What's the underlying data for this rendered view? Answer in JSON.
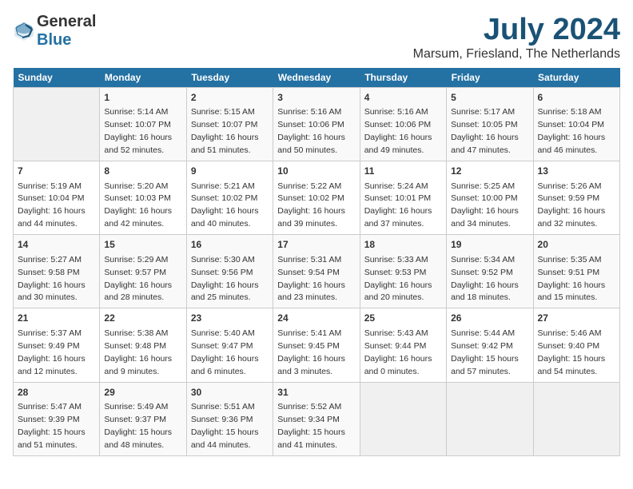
{
  "header": {
    "logo_general": "General",
    "logo_blue": "Blue",
    "month_title": "July 2024",
    "location": "Marsum, Friesland, The Netherlands"
  },
  "days_of_week": [
    "Sunday",
    "Monday",
    "Tuesday",
    "Wednesday",
    "Thursday",
    "Friday",
    "Saturday"
  ],
  "weeks": [
    [
      {
        "day": "",
        "sunrise": "",
        "sunset": "",
        "daylight": ""
      },
      {
        "day": "1",
        "sunrise": "Sunrise: 5:14 AM",
        "sunset": "Sunset: 10:07 PM",
        "daylight": "Daylight: 16 hours and 52 minutes."
      },
      {
        "day": "2",
        "sunrise": "Sunrise: 5:15 AM",
        "sunset": "Sunset: 10:07 PM",
        "daylight": "Daylight: 16 hours and 51 minutes."
      },
      {
        "day": "3",
        "sunrise": "Sunrise: 5:16 AM",
        "sunset": "Sunset: 10:06 PM",
        "daylight": "Daylight: 16 hours and 50 minutes."
      },
      {
        "day": "4",
        "sunrise": "Sunrise: 5:16 AM",
        "sunset": "Sunset: 10:06 PM",
        "daylight": "Daylight: 16 hours and 49 minutes."
      },
      {
        "day": "5",
        "sunrise": "Sunrise: 5:17 AM",
        "sunset": "Sunset: 10:05 PM",
        "daylight": "Daylight: 16 hours and 47 minutes."
      },
      {
        "day": "6",
        "sunrise": "Sunrise: 5:18 AM",
        "sunset": "Sunset: 10:04 PM",
        "daylight": "Daylight: 16 hours and 46 minutes."
      }
    ],
    [
      {
        "day": "7",
        "sunrise": "Sunrise: 5:19 AM",
        "sunset": "Sunset: 10:04 PM",
        "daylight": "Daylight: 16 hours and 44 minutes."
      },
      {
        "day": "8",
        "sunrise": "Sunrise: 5:20 AM",
        "sunset": "Sunset: 10:03 PM",
        "daylight": "Daylight: 16 hours and 42 minutes."
      },
      {
        "day": "9",
        "sunrise": "Sunrise: 5:21 AM",
        "sunset": "Sunset: 10:02 PM",
        "daylight": "Daylight: 16 hours and 40 minutes."
      },
      {
        "day": "10",
        "sunrise": "Sunrise: 5:22 AM",
        "sunset": "Sunset: 10:02 PM",
        "daylight": "Daylight: 16 hours and 39 minutes."
      },
      {
        "day": "11",
        "sunrise": "Sunrise: 5:24 AM",
        "sunset": "Sunset: 10:01 PM",
        "daylight": "Daylight: 16 hours and 37 minutes."
      },
      {
        "day": "12",
        "sunrise": "Sunrise: 5:25 AM",
        "sunset": "Sunset: 10:00 PM",
        "daylight": "Daylight: 16 hours and 34 minutes."
      },
      {
        "day": "13",
        "sunrise": "Sunrise: 5:26 AM",
        "sunset": "Sunset: 9:59 PM",
        "daylight": "Daylight: 16 hours and 32 minutes."
      }
    ],
    [
      {
        "day": "14",
        "sunrise": "Sunrise: 5:27 AM",
        "sunset": "Sunset: 9:58 PM",
        "daylight": "Daylight: 16 hours and 30 minutes."
      },
      {
        "day": "15",
        "sunrise": "Sunrise: 5:29 AM",
        "sunset": "Sunset: 9:57 PM",
        "daylight": "Daylight: 16 hours and 28 minutes."
      },
      {
        "day": "16",
        "sunrise": "Sunrise: 5:30 AM",
        "sunset": "Sunset: 9:56 PM",
        "daylight": "Daylight: 16 hours and 25 minutes."
      },
      {
        "day": "17",
        "sunrise": "Sunrise: 5:31 AM",
        "sunset": "Sunset: 9:54 PM",
        "daylight": "Daylight: 16 hours and 23 minutes."
      },
      {
        "day": "18",
        "sunrise": "Sunrise: 5:33 AM",
        "sunset": "Sunset: 9:53 PM",
        "daylight": "Daylight: 16 hours and 20 minutes."
      },
      {
        "day": "19",
        "sunrise": "Sunrise: 5:34 AM",
        "sunset": "Sunset: 9:52 PM",
        "daylight": "Daylight: 16 hours and 18 minutes."
      },
      {
        "day": "20",
        "sunrise": "Sunrise: 5:35 AM",
        "sunset": "Sunset: 9:51 PM",
        "daylight": "Daylight: 16 hours and 15 minutes."
      }
    ],
    [
      {
        "day": "21",
        "sunrise": "Sunrise: 5:37 AM",
        "sunset": "Sunset: 9:49 PM",
        "daylight": "Daylight: 16 hours and 12 minutes."
      },
      {
        "day": "22",
        "sunrise": "Sunrise: 5:38 AM",
        "sunset": "Sunset: 9:48 PM",
        "daylight": "Daylight: 16 hours and 9 minutes."
      },
      {
        "day": "23",
        "sunrise": "Sunrise: 5:40 AM",
        "sunset": "Sunset: 9:47 PM",
        "daylight": "Daylight: 16 hours and 6 minutes."
      },
      {
        "day": "24",
        "sunrise": "Sunrise: 5:41 AM",
        "sunset": "Sunset: 9:45 PM",
        "daylight": "Daylight: 16 hours and 3 minutes."
      },
      {
        "day": "25",
        "sunrise": "Sunrise: 5:43 AM",
        "sunset": "Sunset: 9:44 PM",
        "daylight": "Daylight: 16 hours and 0 minutes."
      },
      {
        "day": "26",
        "sunrise": "Sunrise: 5:44 AM",
        "sunset": "Sunset: 9:42 PM",
        "daylight": "Daylight: 15 hours and 57 minutes."
      },
      {
        "day": "27",
        "sunrise": "Sunrise: 5:46 AM",
        "sunset": "Sunset: 9:40 PM",
        "daylight": "Daylight: 15 hours and 54 minutes."
      }
    ],
    [
      {
        "day": "28",
        "sunrise": "Sunrise: 5:47 AM",
        "sunset": "Sunset: 9:39 PM",
        "daylight": "Daylight: 15 hours and 51 minutes."
      },
      {
        "day": "29",
        "sunrise": "Sunrise: 5:49 AM",
        "sunset": "Sunset: 9:37 PM",
        "daylight": "Daylight: 15 hours and 48 minutes."
      },
      {
        "day": "30",
        "sunrise": "Sunrise: 5:51 AM",
        "sunset": "Sunset: 9:36 PM",
        "daylight": "Daylight: 15 hours and 44 minutes."
      },
      {
        "day": "31",
        "sunrise": "Sunrise: 5:52 AM",
        "sunset": "Sunset: 9:34 PM",
        "daylight": "Daylight: 15 hours and 41 minutes."
      },
      {
        "day": "",
        "sunrise": "",
        "sunset": "",
        "daylight": ""
      },
      {
        "day": "",
        "sunrise": "",
        "sunset": "",
        "daylight": ""
      },
      {
        "day": "",
        "sunrise": "",
        "sunset": "",
        "daylight": ""
      }
    ]
  ]
}
